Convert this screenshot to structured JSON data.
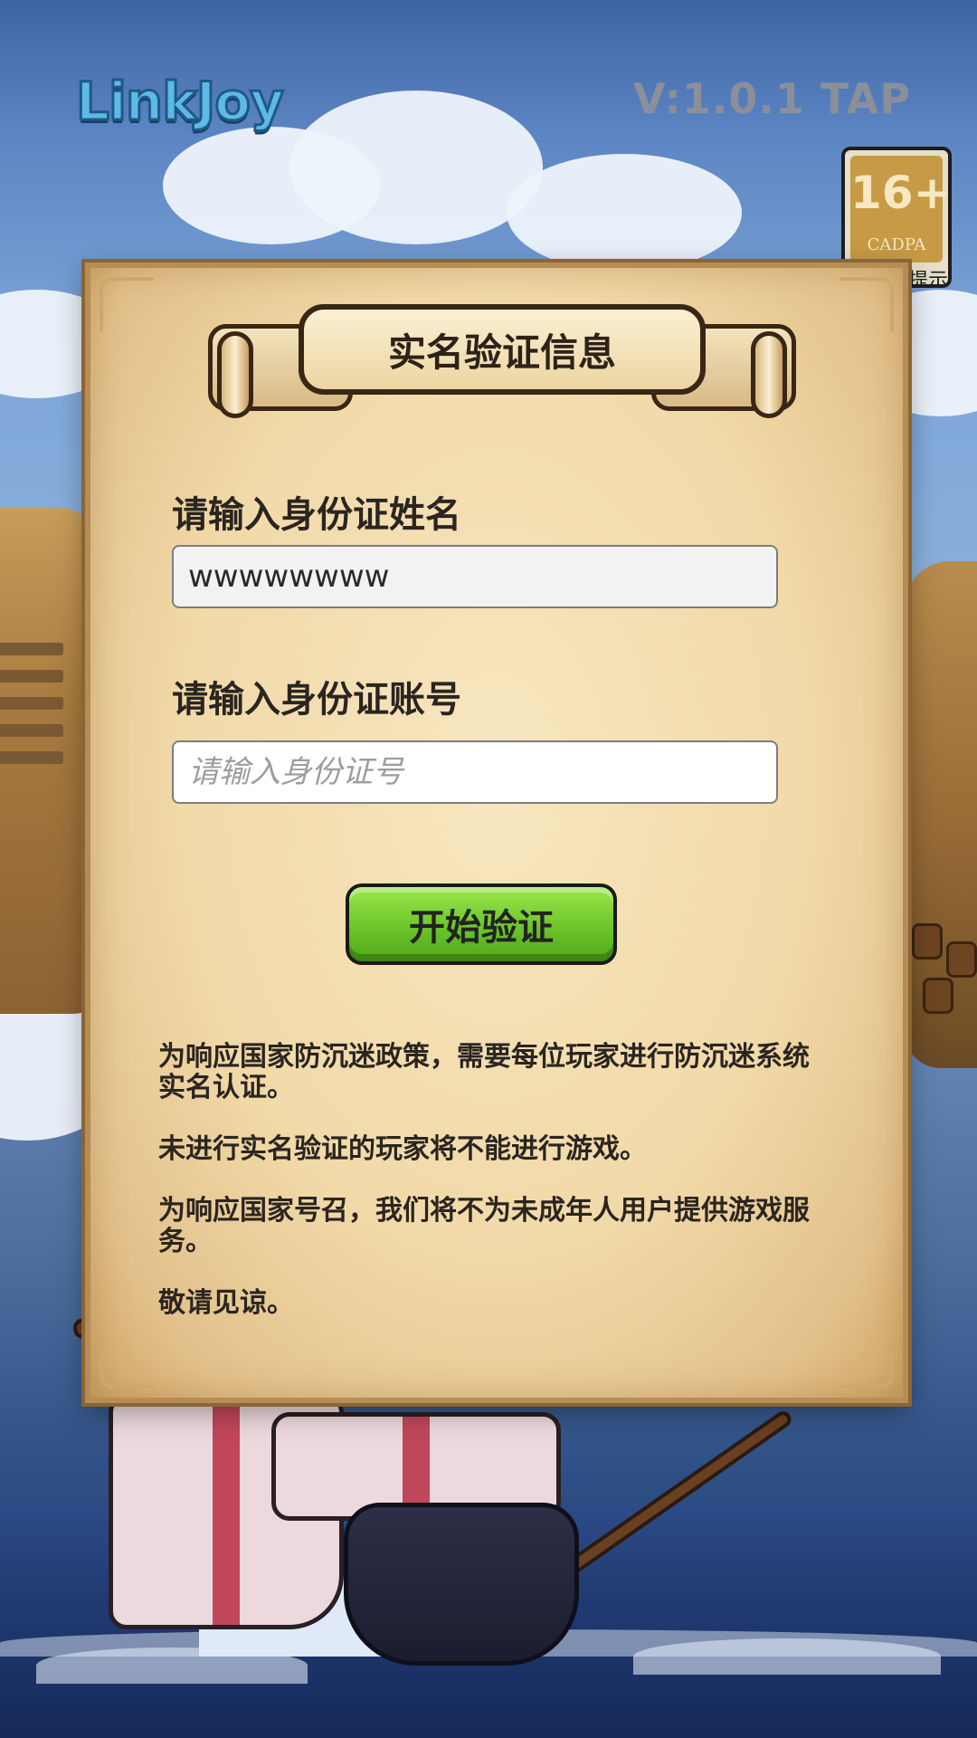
{
  "header": {
    "logo_text": "LinkJoy",
    "version": "V:1.0.1  TAP"
  },
  "age_rating": {
    "number": "16+",
    "org": "CADPA",
    "tip": "提示"
  },
  "dialog": {
    "title": "实名验证信息",
    "name_label": "请输入身份证姓名",
    "name_value": "wwwwwwww",
    "id_label": "请输入身份证账号",
    "id_placeholder": "请输入身份证号",
    "verify_button": "开始验证",
    "notice": [
      "为响应国家防沉迷政策，需要每位玩家进行防沉迷系统实名认证。",
      "未进行实名验证的玩家将不能进行游戏。",
      "为响应国家号召，我们将不为未成年人用户提供游戏服务。",
      "敬请见谅。"
    ]
  },
  "colors": {
    "button_green": "#6cc52a",
    "parchment": "#f1d9a8",
    "logo_blue": "#5fb9e6"
  }
}
